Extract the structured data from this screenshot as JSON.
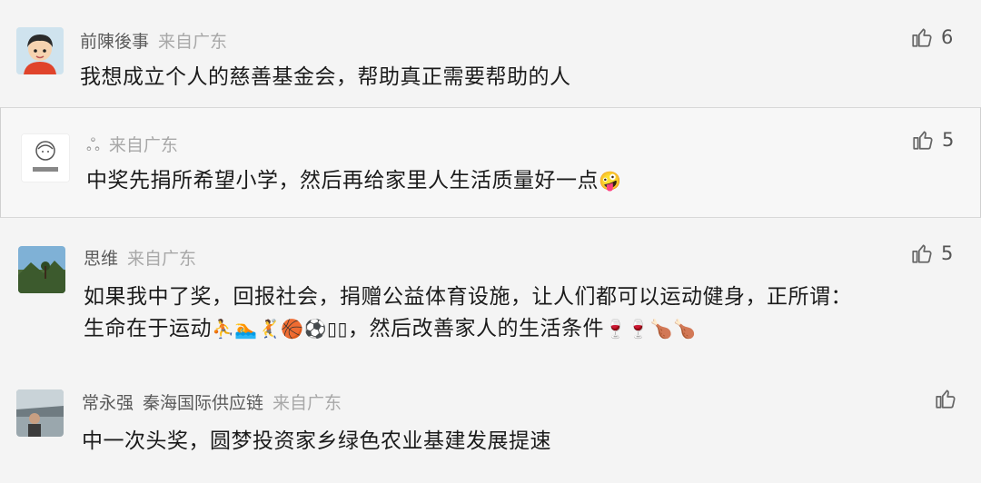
{
  "comments": [
    {
      "name": "前陳後事",
      "location": "来自广东",
      "text": "我想成立个人的慈善基金会，帮助真正需要帮助的人",
      "likes": "6",
      "avatar": "cartoon-boy-avatar"
    },
    {
      "name": "",
      "location": "来自广东",
      "text": "中奖先捐所希望小学，然后再给家里人生活质量好一点",
      "emoji": "🤪",
      "likes": "5",
      "avatar": "line-drawing-avatar"
    },
    {
      "name": "思维",
      "location": "来自广东",
      "text_line1": "如果我中了奖，回报社会，捐赠公益体育设施，让人们都可以运动健身，正所谓：",
      "text_line2": "生命在于运动",
      "emoji_sports": "⛹🏊🤾🏀⚽▯▯",
      "text_line2b": "，然后改善家人的生活条件",
      "emoji_food": "🍷🍷🍗🍗",
      "likes": "5",
      "avatar": "landscape-avatar"
    },
    {
      "name": "常永强",
      "name_extra": "秦海国际供应链",
      "location": "来自广东",
      "text": "中一次头奖，圆梦投资家乡绿色农业基建发展提速",
      "likes": "",
      "avatar": "photo-avatar"
    }
  ]
}
